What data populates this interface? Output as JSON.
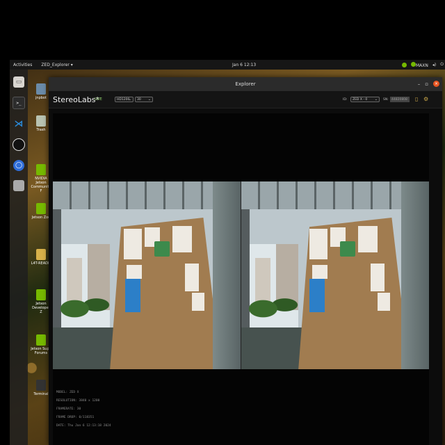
{
  "topbar": {
    "activities": "Activities",
    "app_menu": "ZED_Explorer ▾",
    "clock": "Jan 6 12:13",
    "power_mode": "MAXN",
    "tray_icons": [
      "nvidia-icon",
      "power-mode-icon",
      "volume-icon",
      "power-icon"
    ]
  },
  "dock": {
    "apps": [
      "files-icon",
      "terminal-icon",
      "vscode-icon",
      "obs-icon",
      "chromium-icon",
      "disk-icon"
    ]
  },
  "desktop": {
    "icons": [
      {
        "label": "jnpbot",
        "icon": "folder-icon"
      },
      {
        "label": "Trash",
        "icon": "trash-icon"
      },
      {
        "label": "NVIDIA Jetson Community F",
        "icon": "nvidia-icon"
      },
      {
        "label": "Jetson Zoo",
        "icon": "nvidia-icon"
      },
      {
        "label": "L4T-READM",
        "icon": "document-icon"
      },
      {
        "label": "Jetson Developer Z",
        "icon": "nvidia-icon"
      },
      {
        "label": "Jetson Supp Forums",
        "icon": "nvidia-icon"
      },
      {
        "label": "Terminal",
        "icon": "terminal-icon"
      }
    ]
  },
  "window": {
    "title": "Explorer",
    "controls": {
      "minimize": "–",
      "maximize": "▫",
      "close": "×"
    }
  },
  "toolbar": {
    "logo": "StereoLabs*",
    "live": "LIVE",
    "resolution": "HD1200",
    "fps": "30",
    "id_label": "ID:",
    "camera_select": "ZED X - 0",
    "sn_label": "SN:",
    "serial": "44820808"
  },
  "info": {
    "model": "MODEL: ZED X",
    "resolution": "RESOLUTION: 3840 x 1200",
    "framerate": "FRAMERATE: 30",
    "frame_drop": "FRAME DROP: 0/118351",
    "date": "DATE: Thu Jan 6 12:13:18 2024"
  }
}
